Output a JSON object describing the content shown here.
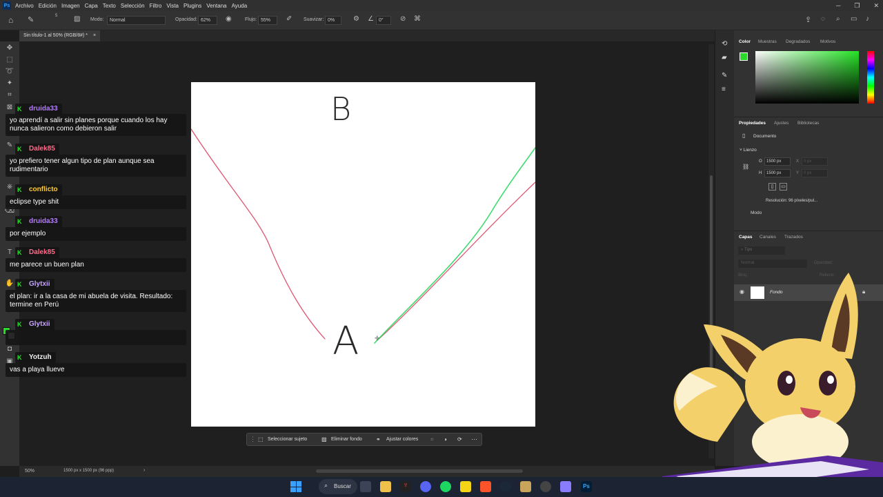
{
  "app": {
    "logo": "Ps"
  },
  "menu": [
    "Archivo",
    "Edición",
    "Imagen",
    "Capa",
    "Texto",
    "Selección",
    "Filtro",
    "Vista",
    "Plugins",
    "Ventana",
    "Ayuda"
  ],
  "options": {
    "mode_label": "Modo:",
    "mode_value": "Normal",
    "opacity_label": "Opacidad:",
    "opacity_value": "62%",
    "flow_label": "Flujo:",
    "flow_value": "55%",
    "smooth_label": "Suavizar:",
    "smooth_value": "0%",
    "angle_value": "0°",
    "brush_size": "5"
  },
  "document_tab": {
    "title": "Sin título-1 al 50% (RGB/8#) *",
    "close": "×"
  },
  "canvas": {
    "letter_b": "B",
    "letter_a": "A",
    "red_color": "#e0556f",
    "green_color": "#3cdc6e"
  },
  "status": {
    "zoom": "50%",
    "info": "1500 px x 1500 px (96 ppp)",
    "arrow": "›"
  },
  "context_bar": {
    "select_subject": "Seleccionar sujeto",
    "remove_bg": "Eliminar fondo",
    "adjust_colors": "Ajustar colores",
    "more": "···"
  },
  "color_panel": {
    "tabs": [
      "Color",
      "Muestras",
      "Degradados",
      "Motivos"
    ],
    "foreground": "#2bd92b"
  },
  "properties_panel": {
    "tabs": [
      "Propiedades",
      "Ajustes",
      "Bibliotecas"
    ],
    "doc_label": "Documento",
    "section": "Lienzo",
    "width_label": "O",
    "width_value": "1500 px",
    "height_label": "H",
    "height_value": "1500 px",
    "x_label": "X",
    "x_placeholder": "0 px",
    "y_label": "Y",
    "y_placeholder": "0 px",
    "resolution": "Resolución: 96 píxeles/pul...",
    "mode": "Modo"
  },
  "layers_panel": {
    "tabs": [
      "Capas",
      "Canales",
      "Trazados"
    ],
    "filter_placeholder": "Tipo",
    "blend": "Normal",
    "opacity_label": "Opacidad:",
    "lock_label": "Bloq.:",
    "fill_label": "Relleno:",
    "layer_name": "Fondo"
  },
  "chat": [
    {
      "user": "druida33",
      "color": "#b57cff",
      "text": "yo aprendí a salir sin planes porque cuando los hay nunca salieron como debieron salir"
    },
    {
      "user": "Dalek85",
      "color": "#ff6a8a",
      "text": "yo prefiero tener algun tipo de plan aunque sea rudimentario"
    },
    {
      "user": "conflicto",
      "color": "#ffcc33",
      "text": "eclipse type shit"
    },
    {
      "user": "druida33",
      "color": "#b57cff",
      "text": "por ejemplo"
    },
    {
      "user": "Dalek85",
      "color": "#ff6a8a",
      "text": "me parece un buen plan"
    },
    {
      "user": "Glytxii",
      "color": "#c7a4ff",
      "text": "el plan: ir a la casa de mi abuela de visita. Resultado: termine en Perú"
    },
    {
      "user": "Glytxii",
      "color": "#c7a4ff",
      "text": ""
    },
    {
      "user": "Yotzuh",
      "color": "#f0f0f0",
      "text": "vas a playa llueve"
    }
  ],
  "taskbar": {
    "search": "Buscar"
  }
}
